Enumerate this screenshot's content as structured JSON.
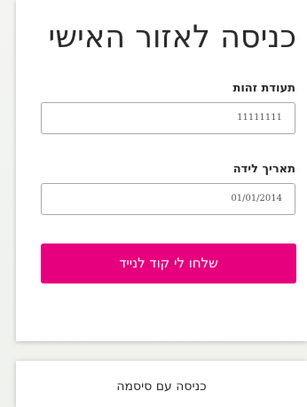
{
  "login": {
    "title": "כניסה לאזור האישי",
    "id_label": "תעודת זהות",
    "id_value": "11111111",
    "dob_label": "תאריך לידה",
    "dob_value": "01/01/2014",
    "send_code_label": "שלחו לי קוד לנייד"
  },
  "password_login": {
    "label": "כניסה עם סיסמה"
  },
  "colors": {
    "accent": "#e6007e",
    "background": "#f0f2ee",
    "text": "#2b2b2b",
    "field_border": "#a9a9a9"
  }
}
